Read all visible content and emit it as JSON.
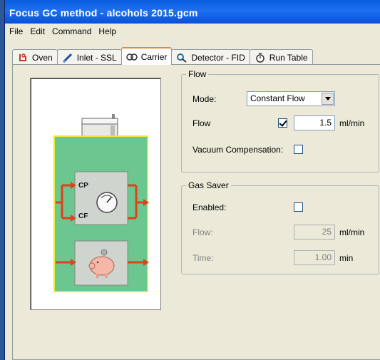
{
  "window": {
    "title": "Focus GC method - alcohols 2015.gcm"
  },
  "menu": [
    "File",
    "Edit",
    "Command",
    "Help"
  ],
  "tabs": [
    {
      "label": "Oven",
      "icon": "oven-icon"
    },
    {
      "label": "Inlet - SSL",
      "icon": "syringe-icon"
    },
    {
      "label": "Carrier",
      "icon": "carrier-icon",
      "active": true
    },
    {
      "label": "Detector - FID",
      "icon": "magnifier-icon"
    },
    {
      "label": "Run Table",
      "icon": "stopwatch-icon"
    }
  ],
  "diagram": {
    "cp_label": "CP",
    "cf_label": "CF",
    "colors": {
      "panel_green": "#6cc68f",
      "panel_border": "#e8e83c",
      "arrow_red": "#e0401a"
    }
  },
  "flow": {
    "legend": "Flow",
    "mode_label": "Mode:",
    "mode_value": "Constant Flow",
    "flow_label": "Flow",
    "flow_checked": true,
    "flow_value": "1.5",
    "flow_unit": "ml/min",
    "vacuum_label": "Vacuum Compensation:",
    "vacuum_checked": false
  },
  "gas_saver": {
    "legend": "Gas Saver",
    "enabled_label": "Enabled:",
    "enabled_checked": false,
    "flow_label": "Flow:",
    "flow_value": "25",
    "flow_unit": "ml/min",
    "time_label": "Time:",
    "time_value": "1.00",
    "time_unit": "min"
  }
}
